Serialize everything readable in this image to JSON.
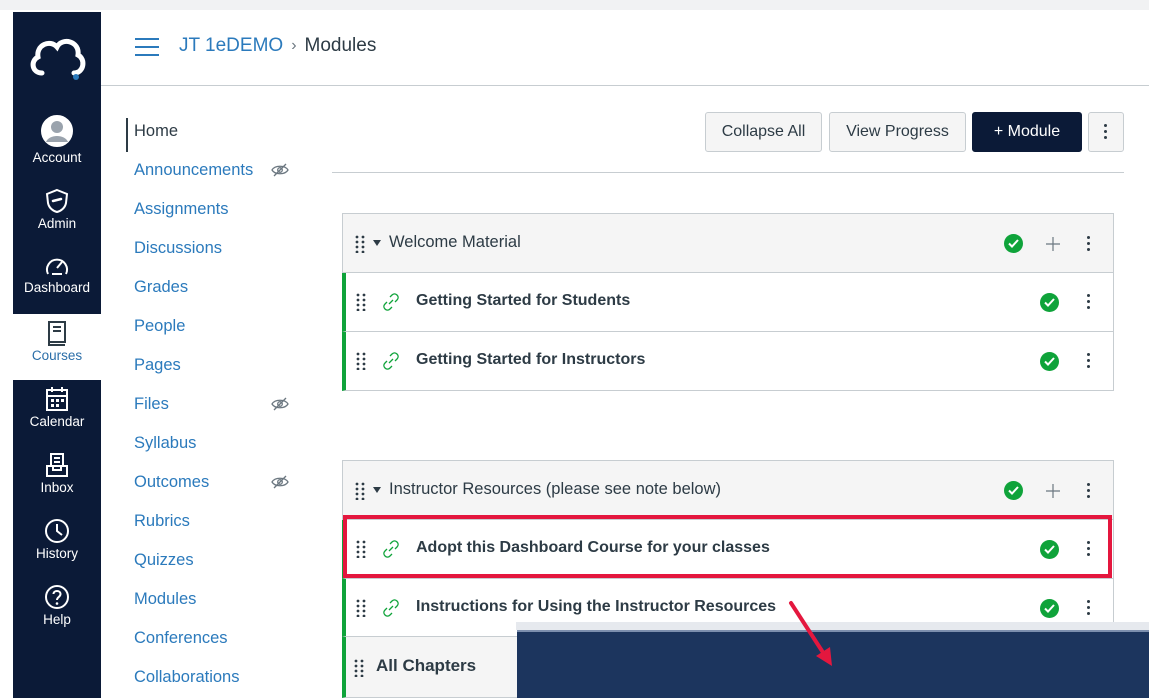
{
  "global_nav": {
    "items": [
      {
        "label": "Account",
        "icon": "account-icon"
      },
      {
        "label": "Admin",
        "icon": "admin-icon"
      },
      {
        "label": "Dashboard",
        "icon": "dashboard-icon"
      },
      {
        "label": "Courses",
        "icon": "courses-icon"
      },
      {
        "label": "Calendar",
        "icon": "calendar-icon"
      },
      {
        "label": "Inbox",
        "icon": "inbox-icon"
      },
      {
        "label": "History",
        "icon": "history-icon"
      },
      {
        "label": "Help",
        "icon": "help-icon"
      }
    ],
    "colors": {
      "bg": "#0b1a37",
      "active": "#2b6ea8"
    }
  },
  "breadcrumb": {
    "course": "JT 1eDEMO",
    "current": "Modules"
  },
  "course_nav": {
    "items": [
      {
        "label": "Home"
      },
      {
        "label": "Announcements",
        "hidden": true
      },
      {
        "label": "Assignments"
      },
      {
        "label": "Discussions"
      },
      {
        "label": "Grades"
      },
      {
        "label": "People"
      },
      {
        "label": "Pages"
      },
      {
        "label": "Files",
        "hidden": true
      },
      {
        "label": "Syllabus"
      },
      {
        "label": "Outcomes",
        "hidden": true
      },
      {
        "label": "Rubrics"
      },
      {
        "label": "Quizzes"
      },
      {
        "label": "Modules"
      },
      {
        "label": "Conferences"
      },
      {
        "label": "Collaborations"
      }
    ]
  },
  "toolbar": {
    "collapse_all": "Collapse All",
    "view_progress": "View Progress",
    "add_module": "+ Module"
  },
  "modules": [
    {
      "title": "Welcome Material",
      "items": [
        {
          "title": "Getting Started for Students"
        },
        {
          "title": "Getting Started for Instructors"
        }
      ]
    },
    {
      "title": "Instructor Resources (please see note below)",
      "items": [
        {
          "title": "Adopt this Dashboard Course for your classes"
        },
        {
          "title": "Instructions for Using the Instructor Resources"
        }
      ]
    },
    {
      "title": "All Chapters"
    }
  ],
  "colors": {
    "link": "#2b7abc",
    "success": "#0fa33a",
    "highlight": "#e4173e"
  }
}
